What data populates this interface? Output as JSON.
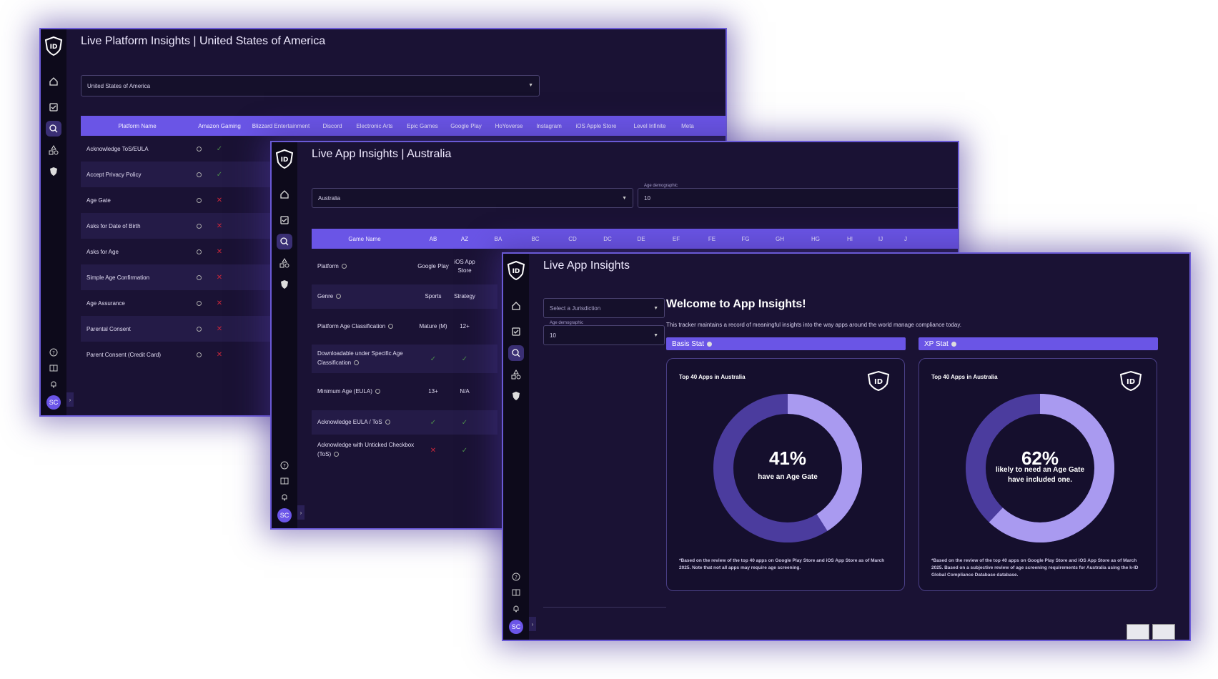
{
  "brand": {
    "logo_text": "k-ID"
  },
  "colors": {
    "accent": "#6a55e6",
    "check": "#4c8b4a",
    "cross": "#c8263a",
    "donut_light": "#a99af0",
    "donut_dark": "#4b3c9e"
  },
  "sidebar": {
    "icons": [
      "home-icon",
      "checklist-icon",
      "insights-icon",
      "shapes-icon",
      "shield-icon"
    ],
    "bottom_icons": [
      "help-icon",
      "book-icon",
      "bell-icon"
    ],
    "avatar": "SC",
    "collapse": "›"
  },
  "win1": {
    "title": "Live Platform Insights | United States of America",
    "select_value": "United States of America",
    "columns": [
      "Platform Name",
      "Amazon Gaming",
      "Blizzard Entertainment",
      "Discord",
      "Electronic Arts",
      "Epic Games",
      "Google Play",
      "HoYoverse",
      "Instagram",
      "iOS Apple Store",
      "Level Infinite",
      "Meta"
    ],
    "rows": [
      {
        "name": "Acknowledge ToS/EULA",
        "mark": "✓"
      },
      {
        "name": "Accept Privacy Policy",
        "mark": "✓"
      },
      {
        "name": "Age Gate",
        "mark": "✕"
      },
      {
        "name": "Asks for Date of Birth",
        "mark": "✕"
      },
      {
        "name": "Asks for Age",
        "mark": "✕"
      },
      {
        "name": "Simple Age Confirmation",
        "mark": "✕"
      },
      {
        "name": "Age Assurance",
        "mark": "✕"
      },
      {
        "name": "Parental Consent",
        "mark": "✕"
      },
      {
        "name": "Parent Consent (Credit Card)",
        "mark": "✕"
      }
    ]
  },
  "win2": {
    "title": "Live App Insights | Australia",
    "select_value": "Australia",
    "age_label": "Age demographic",
    "age_value": "10",
    "columns": [
      "Game Name",
      "AB",
      "AZ",
      "BA",
      "BC",
      "CD",
      "DC",
      "DE",
      "EF",
      "FE",
      "FG",
      "GH",
      "HG",
      "HI",
      "IJ",
      "J"
    ],
    "rows": [
      {
        "name": "Platform",
        "ab": "Google Play",
        "az": "iOS App Store"
      },
      {
        "name": "Genre",
        "ab": "Sports",
        "az": "Strategy"
      },
      {
        "name": "Platform Age Classification",
        "ab": "Mature (M)",
        "az": "12+"
      },
      {
        "name": "Downloadable under Specific Age Classification",
        "ab": "✓",
        "az": "✓"
      },
      {
        "name": "Minimum Age (EULA)",
        "ab": "13+",
        "az": "N/A"
      },
      {
        "name": "Acknowledge EULA / ToS",
        "ab": "✓",
        "az": "✓"
      },
      {
        "name": "Acknowledge with Unticked Checkbox (ToS)",
        "ab": "✕",
        "az": "✓"
      }
    ]
  },
  "win3": {
    "title": "Live App Insights",
    "jurisdiction_placeholder": "Select a Jurisdiction",
    "age_label": "Age demographic",
    "age_value": "10",
    "welcome": "Welcome to App Insights!",
    "subtext": "This tracker maintains a record of meaningful insights into the way apps around the world manage compliance today.",
    "cards": [
      {
        "stat_label": "Basis Stat",
        "title": "Top 40 Apps in Australia",
        "percent": 41,
        "percent_text": "41%",
        "line1": "have an Age Gate",
        "line2": "",
        "footnote": "*Based on the review of the top 40 apps on Google Play Store and iOS App Store as of March 2025. Note that not all apps may require age screening."
      },
      {
        "stat_label": "XP Stat",
        "title": "Top 40 Apps in Australia",
        "percent": 62,
        "percent_text": "62%",
        "line1": "likely to need an Age Gate",
        "line2": "have included one.",
        "footnote": "*Based on the review of the top 40 apps on Google Play Store and iOS App Store as of March 2025. Based on a subjective review of age screening requirements for Australia using the k-ID Global Compliance Database database."
      }
    ]
  }
}
